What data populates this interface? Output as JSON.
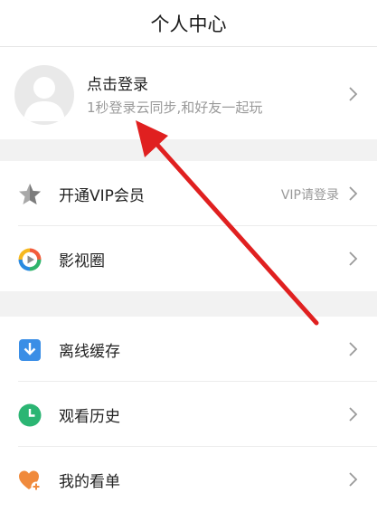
{
  "header": {
    "title": "个人中心"
  },
  "profile": {
    "name": "点击登录",
    "subtitle": "1秒登录云同步,和好友一起玩"
  },
  "menu": [
    {
      "label": "开通VIP会员",
      "right_text": "VIP请登录",
      "icon": "star-icon"
    },
    {
      "label": "影视圈",
      "right_text": "",
      "icon": "play-circle-icon"
    },
    {
      "label": "离线缓存",
      "right_text": "",
      "icon": "download-icon"
    },
    {
      "label": "观看历史",
      "right_text": "",
      "icon": "clock-icon"
    },
    {
      "label": "我的看单",
      "right_text": "",
      "icon": "heart-plus-icon"
    }
  ],
  "colors": {
    "annotation_arrow": "#e02020",
    "download_icon": "#3a8ee6",
    "clock_icon": "#2bb573",
    "heart_icon": "#f08a3c"
  }
}
